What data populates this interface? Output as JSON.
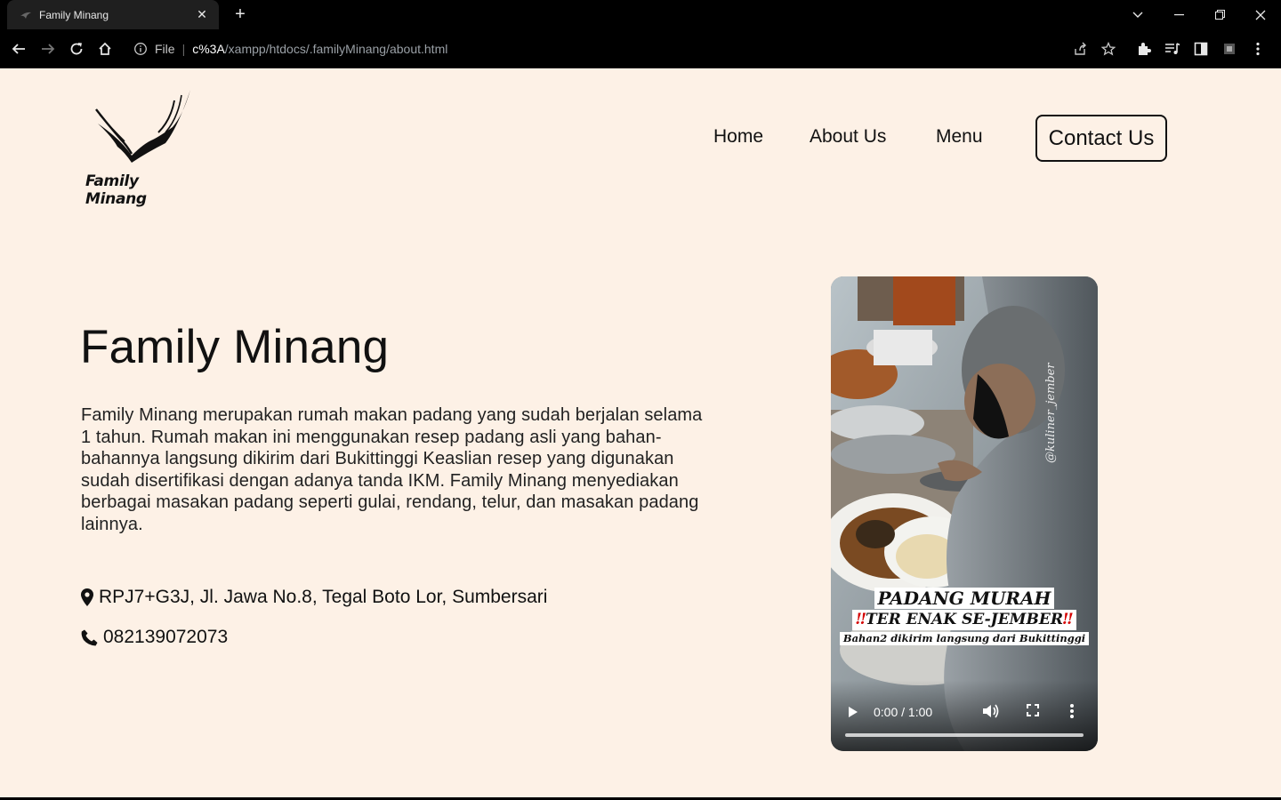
{
  "browser": {
    "tab_title": "Family Minang",
    "url_scheme": "File",
    "url_host_part": "c%3A",
    "url_path_part": "/xampp/htdocs/.familyMinang/about.html"
  },
  "site": {
    "logo_text": "Family Minang",
    "nav": {
      "home": "Home",
      "about": "About Us",
      "menu": "Menu",
      "contact": "Contact Us"
    }
  },
  "hero": {
    "title": "Family Minang",
    "description": "Family Minang merupakan rumah makan padang yang sudah berjalan selama 1 tahun. Rumah makan ini menggunakan resep padang asli yang bahan-bahannya langsung dikirim dari Bukittinggi Keaslian resep yang digunakan sudah disertifikasi dengan adanya tanda IKM. Family Minang menyediakan berbagai masakan padang seperti gulai, rendang, telur, dan masakan padang lainnya.",
    "address": "RPJ7+G3J, Jl. Jawa No.8, Tegal Boto Lor, Sumbersari",
    "phone": "082139072073"
  },
  "video": {
    "caption_line1": "PADANG MURAH",
    "caption_line2": "TER ENAK SE-JEMBER",
    "caption_bang": "‼",
    "caption_line3": "Bahan2 dikirim langsung dari Bukittinggi",
    "watermark": "@kuliner_jember",
    "time": "0:00 / 1:00",
    "progress": 0
  }
}
